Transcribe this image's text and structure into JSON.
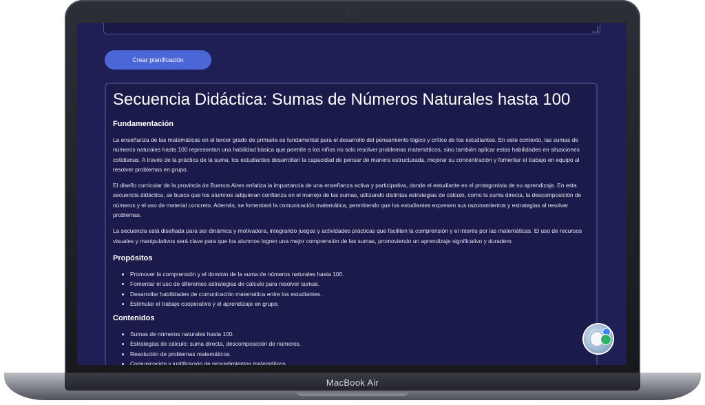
{
  "device": {
    "brand_label": "MacBook Air"
  },
  "form": {
    "create_button_label": "Crear planificación"
  },
  "document": {
    "title": "Secuencia Didáctica: Sumas de Números Naturales hasta 100",
    "fundamentacion": {
      "heading": "Fundamentación",
      "paragraphs": [
        "La enseñanza de las matemáticas en el tercer grado de primaria es fundamental para el desarrollo del pensamiento lógico y crítico de los estudiantes. En este contexto, las sumas de números naturales hasta 100 representan una habilidad básica que permite a los niños no solo resolver problemas matemáticos, sino también aplicar estas habilidades en situaciones cotidianas. A través de la práctica de la suma, los estudiantes desarrollan la capacidad de pensar de manera estructurada, mejorar su concentración y fomentar el trabajo en equipo al resolver problemas en grupo.",
        "El diseño curricular de la provincia de Buenos Aires enfatiza la importancia de una enseñanza activa y participativa, donde el estudiante es el protagonista de su aprendizaje. En esta secuencia didáctica, se busca que los alumnos adquieran confianza en el manejo de las sumas, utilizando distintas estrategias de cálculo, como la suma directa, la descomposición de números y el uso de material concreto. Además, se fomentará la comunicación matemática, permitiendo que los estudiantes expresen sus razonamientos y estrategias al resolver problemas.",
        "La secuencia está diseñada para ser dinámica y motivadora, integrando juegos y actividades prácticas que faciliten la comprensión y el interés por las matemáticas. El uso de recursos visuales y manipulativos será clave para que los alumnos logren una mejor comprensión de las sumas, promoviendo un aprendizaje significativo y duradero."
      ]
    },
    "propositos": {
      "heading": "Propósitos",
      "items": [
        "Promover la comprensión y el dominio de la suma de números naturales hasta 100.",
        "Fomentar el uso de diferentes estrategias de cálculo para resolver sumas.",
        "Desarrollar habilidades de comunicación matemática entre los estudiantes.",
        "Estimular el trabajo cooperativo y el aprendizaje en grupo."
      ]
    },
    "contenidos": {
      "heading": "Contenidos",
      "items": [
        "Sumas de números naturales hasta 100.",
        "Estrategias de cálculo: suma directa, descomposición de números.",
        "Resolución de problemas matemáticos.",
        "Comunicación y justificación de procedimientos matemáticos."
      ]
    }
  },
  "assistant": {
    "icon": "assistant-avatar-icon"
  },
  "colors": {
    "screen_bg": "#201f55",
    "card_bg": "#1a1b4b",
    "button_bg": "#4b66d6"
  }
}
